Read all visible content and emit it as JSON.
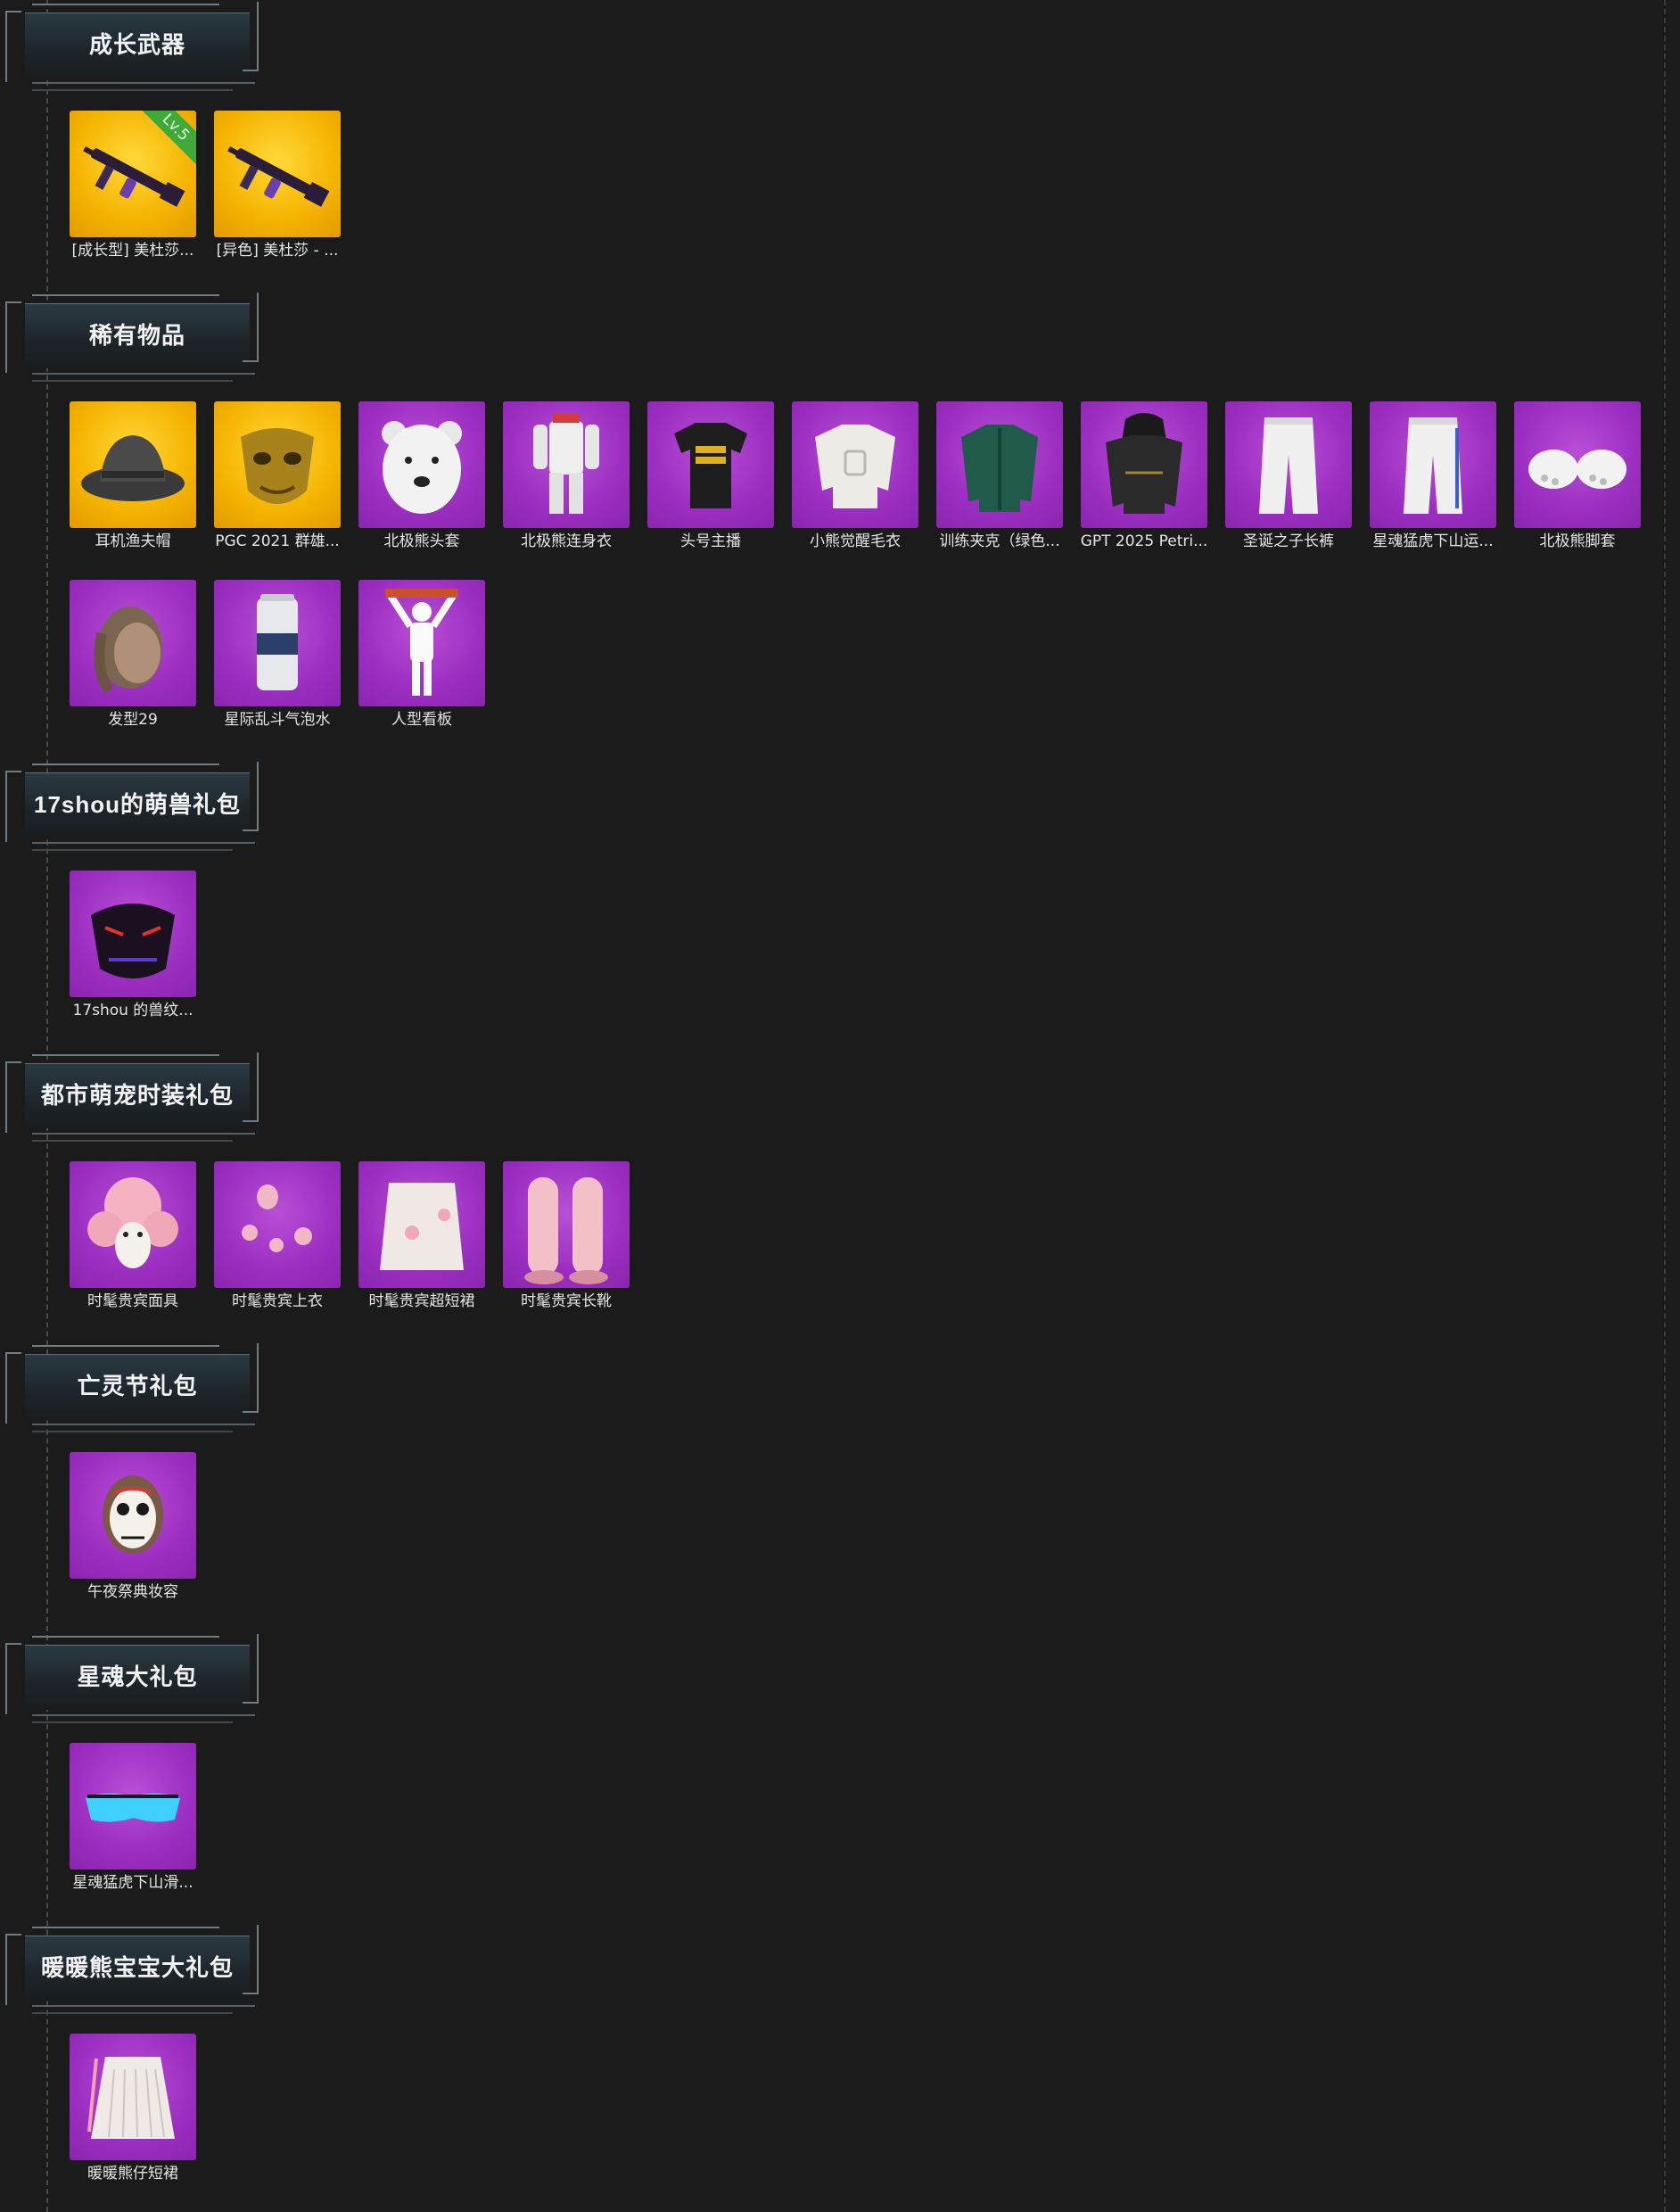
{
  "sections": [
    {
      "title": "成长武器",
      "items": [
        {
          "label": "[成长型] 美杜莎...",
          "bg": "yellow",
          "icon": "rifle-icon",
          "badge": "Lv.5"
        },
        {
          "label": "[异色] 美杜莎 - ...",
          "bg": "yellow",
          "icon": "rifle-icon"
        }
      ]
    },
    {
      "title": "稀有物品",
      "items": [
        {
          "label": "耳机渔夫帽",
          "bg": "yellow",
          "icon": "bucket-hat-icon"
        },
        {
          "label": "PGC 2021 群雄...",
          "bg": "yellow",
          "icon": "gold-mask-icon"
        },
        {
          "label": "北极熊头套",
          "bg": "purple",
          "icon": "polar-bear-head-icon"
        },
        {
          "label": "北极熊连身衣",
          "bg": "purple",
          "icon": "jumpsuit-icon"
        },
        {
          "label": "头号主播",
          "bg": "purple",
          "icon": "tshirt-icon"
        },
        {
          "label": "小熊觉醒毛衣",
          "bg": "purple",
          "icon": "sweater-icon"
        },
        {
          "label": "训练夹克（绿色...",
          "bg": "purple",
          "icon": "jacket-icon"
        },
        {
          "label": "GPT 2025 Petri...",
          "bg": "purple",
          "icon": "hoodie-icon"
        },
        {
          "label": "圣诞之子长裤",
          "bg": "purple",
          "icon": "pants-icon"
        },
        {
          "label": "星魂猛虎下山运...",
          "bg": "purple",
          "icon": "track-pants-icon"
        },
        {
          "label": "北极熊脚套",
          "bg": "purple",
          "icon": "paw-boots-icon"
        },
        {
          "label": "发型29",
          "bg": "purple",
          "icon": "hairstyle-icon"
        },
        {
          "label": "星际乱斗气泡水",
          "bg": "purple",
          "icon": "soda-can-icon"
        },
        {
          "label": "人型看板",
          "bg": "purple",
          "icon": "human-sign-icon"
        }
      ]
    },
    {
      "title": "17shou的萌兽礼包",
      "items": [
        {
          "label": "17shou 的兽纹...",
          "bg": "purple",
          "icon": "beast-mask-icon"
        }
      ]
    },
    {
      "title": "都市萌宠时装礼包",
      "items": [
        {
          "label": "时髦贵宾面具",
          "bg": "purple",
          "icon": "poodle-mask-icon"
        },
        {
          "label": "时髦贵宾上衣",
          "bg": "purple",
          "icon": "fluffy-top-icon"
        },
        {
          "label": "时髦贵宾超短裙",
          "bg": "purple",
          "icon": "fluffy-skirt-icon"
        },
        {
          "label": "时髦贵宾长靴",
          "bg": "purple",
          "icon": "fluffy-boots-icon"
        }
      ]
    },
    {
      "title": "亡灵节礼包",
      "items": [
        {
          "label": "午夜祭典妆容",
          "bg": "purple",
          "icon": "skull-makeup-icon"
        }
      ]
    },
    {
      "title": "星魂大礼包",
      "items": [
        {
          "label": "星魂猛虎下山滑...",
          "bg": "purple",
          "icon": "ski-goggles-icon"
        }
      ]
    },
    {
      "title": "暖暖熊宝宝大礼包",
      "items": [
        {
          "label": "暖暖熊仔短裙",
          "bg": "purple",
          "icon": "pleated-skirt-icon"
        }
      ]
    }
  ],
  "colors": {
    "background": "#1b1b1b",
    "legendary": "#f5b300",
    "epic": "#9b2ec1",
    "level_badge": "#3faa3a"
  }
}
